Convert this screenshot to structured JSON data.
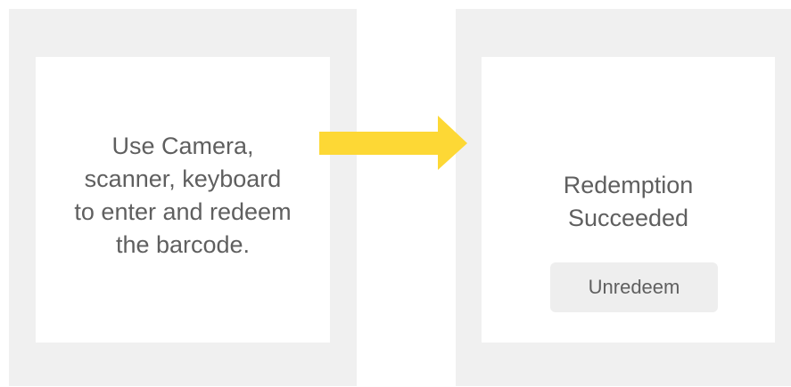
{
  "left_card": {
    "text": "Use Camera,\nscanner, keyboard\nto enter and redeem\nthe barcode."
  },
  "right_card": {
    "text": "Redemption\nSucceeded",
    "button_label": "Unredeem"
  },
  "arrow": {
    "icon": "right-arrow-icon",
    "color": "#fdd835"
  },
  "colors": {
    "panel": "#f0f0f0",
    "card": "#ffffff",
    "text": "#5f5f5f",
    "button": "#eeeeee"
  }
}
